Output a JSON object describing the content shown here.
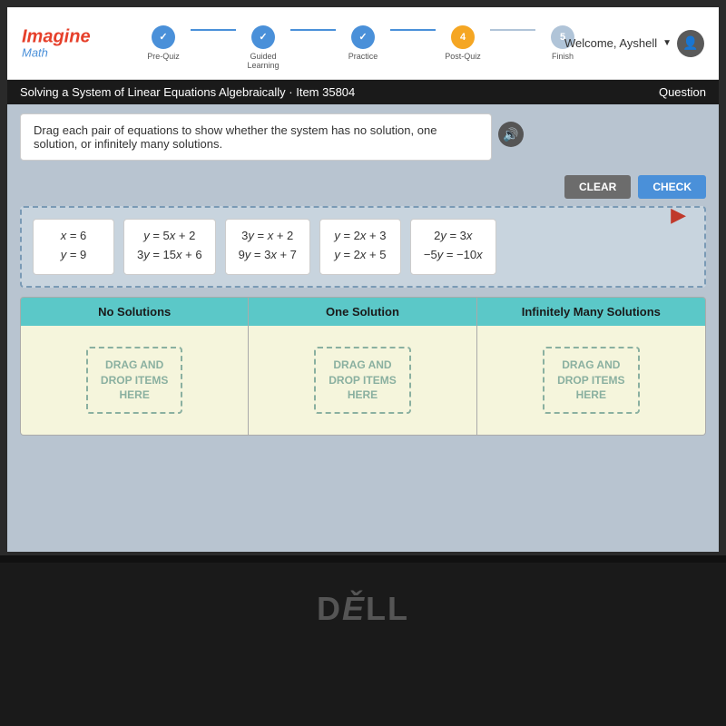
{
  "screen": {
    "title": "Solving a System of Linear Equations Algebraically · Item 35804",
    "question_label": "Question"
  },
  "nav": {
    "logo_imagine": "Imagine",
    "logo_math": "Math",
    "welcome_text": "Welcome, Ayshell",
    "steps": [
      {
        "id": "pre-quiz",
        "label": "Pre-Quiz",
        "state": "completed",
        "number": "✓"
      },
      {
        "id": "guided-learning",
        "label": "Guided\nLearning",
        "state": "completed",
        "number": "✓"
      },
      {
        "id": "practice",
        "label": "Practice",
        "state": "completed",
        "number": "✓"
      },
      {
        "id": "post-quiz",
        "label": "Post-Quiz",
        "state": "active",
        "number": "4"
      },
      {
        "id": "finish",
        "label": "Finish",
        "state": "future",
        "number": "5"
      }
    ]
  },
  "instruction": {
    "text": "Drag each pair of equations to show whether the system has no solution, one solution, or infinitely many solutions."
  },
  "buttons": {
    "clear_label": "CLEAR",
    "check_label": "CHECK"
  },
  "equations": [
    {
      "id": "eq1",
      "line1": "x = 6",
      "line2": "y = 9"
    },
    {
      "id": "eq2",
      "line1": "y = 5x + 2",
      "line2": "3y = 15x + 6"
    },
    {
      "id": "eq3",
      "line1": "3y = x + 2",
      "line2": "9y = 3x + 7"
    },
    {
      "id": "eq4",
      "line1": "y = 2x + 3",
      "line2": "y = 2x + 5"
    },
    {
      "id": "eq5",
      "line1": "2y = 3x",
      "line2": "-5y = -10x"
    }
  ],
  "drop_zones": [
    {
      "id": "no-solutions",
      "label": "No Solutions",
      "hint": "DRAG AND\nDROP ITEMS\nHERE"
    },
    {
      "id": "one-solution",
      "label": "One Solution",
      "hint": "DRAG AND\nDROP ITEMS\nHERE"
    },
    {
      "id": "infinitely-many",
      "label": "Infinitely Many Solutions",
      "hint": "DRAG AND\nDROP ITEMS\nHERE"
    }
  ],
  "dell_logo": "DELL"
}
